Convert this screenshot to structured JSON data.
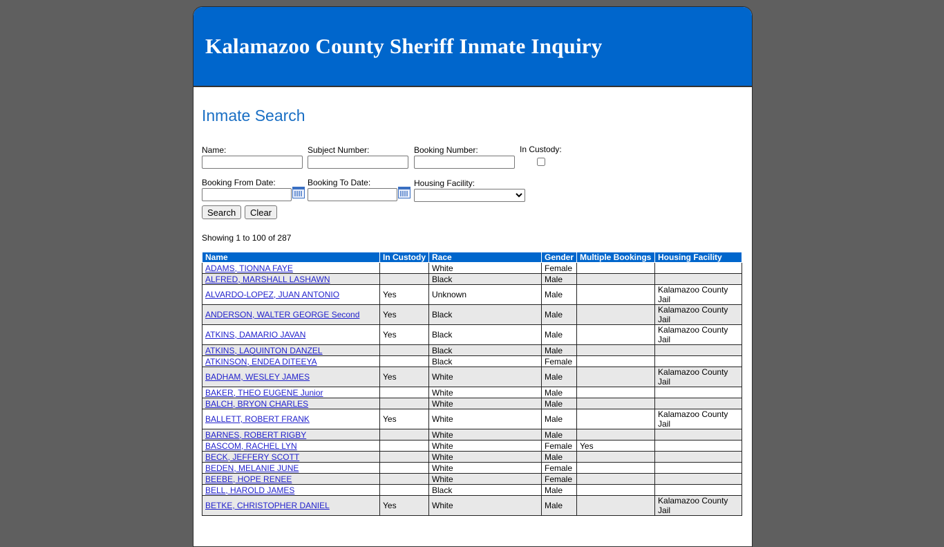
{
  "header": {
    "title": "Kalamazoo County Sheriff Inmate Inquiry"
  },
  "search": {
    "heading": "Inmate Search",
    "name_label": "Name:",
    "subject_label": "Subject Number:",
    "booking_label": "Booking Number:",
    "custody_label": "In Custody:",
    "from_date_label": "Booking From Date:",
    "to_date_label": "Booking To Date:",
    "facility_label": "Housing Facility:",
    "search_button": "Search",
    "clear_button": "Clear"
  },
  "results": {
    "showing": "Showing 1 to 100 of 287",
    "columns": [
      "Name",
      "In Custody",
      "Race",
      "Gender",
      "Multiple Bookings",
      "Housing Facility"
    ],
    "rows": [
      {
        "name": "ADAMS, TIONNA FAYE",
        "custody": "",
        "race": "White",
        "gender": "Female",
        "multiple": "",
        "facility": ""
      },
      {
        "name": "ALFRED, MARSHALL LASHAWN",
        "custody": "",
        "race": "Black",
        "gender": "Male",
        "multiple": "",
        "facility": ""
      },
      {
        "name": "ALVARDO-LOPEZ, JUAN ANTONIO",
        "custody": "Yes",
        "race": "Unknown",
        "gender": "Male",
        "multiple": "",
        "facility": "Kalamazoo County Jail"
      },
      {
        "name": "ANDERSON, WALTER GEORGE Second",
        "custody": "Yes",
        "race": "Black",
        "gender": "Male",
        "multiple": "",
        "facility": "Kalamazoo County Jail"
      },
      {
        "name": "ATKINS, DAMARIO JAVAN",
        "custody": "Yes",
        "race": "Black",
        "gender": "Male",
        "multiple": "",
        "facility": "Kalamazoo County Jail"
      },
      {
        "name": "ATKINS, LAQUINTON DANZEL",
        "custody": "",
        "race": "Black",
        "gender": "Male",
        "multiple": "",
        "facility": ""
      },
      {
        "name": "ATKINSON, ENDEA DITEEYA",
        "custody": "",
        "race": "Black",
        "gender": "Female",
        "multiple": "",
        "facility": ""
      },
      {
        "name": "BADHAM, WESLEY JAMES",
        "custody": "Yes",
        "race": "White",
        "gender": "Male",
        "multiple": "",
        "facility": "Kalamazoo County Jail"
      },
      {
        "name": "BAKER, THEO EUGENE Junior",
        "custody": "",
        "race": "White",
        "gender": "Male",
        "multiple": "",
        "facility": ""
      },
      {
        "name": "BALCH, BRYON CHARLES",
        "custody": "",
        "race": "White",
        "gender": "Male",
        "multiple": "",
        "facility": ""
      },
      {
        "name": "BALLETT, ROBERT FRANK",
        "custody": "Yes",
        "race": "White",
        "gender": "Male",
        "multiple": "",
        "facility": "Kalamazoo County Jail"
      },
      {
        "name": "BARNES, ROBERT RIGBY",
        "custody": "",
        "race": "White",
        "gender": "Male",
        "multiple": "",
        "facility": ""
      },
      {
        "name": "BASCOM, RACHEL LYN",
        "custody": "",
        "race": "White",
        "gender": "Female",
        "multiple": "Yes",
        "facility": ""
      },
      {
        "name": "BECK, JEFFERY SCOTT",
        "custody": "",
        "race": "White",
        "gender": "Male",
        "multiple": "",
        "facility": ""
      },
      {
        "name": "BEDEN, MELANIE JUNE",
        "custody": "",
        "race": "White",
        "gender": "Female",
        "multiple": "",
        "facility": ""
      },
      {
        "name": "BEEBE, HOPE RENEE",
        "custody": "",
        "race": "White",
        "gender": "Female",
        "multiple": "",
        "facility": ""
      },
      {
        "name": "BELL, HAROLD JAMES",
        "custody": "",
        "race": "Black",
        "gender": "Male",
        "multiple": "",
        "facility": ""
      },
      {
        "name": "BETKE, CHRISTOPHER DANIEL",
        "custody": "Yes",
        "race": "White",
        "gender": "Male",
        "multiple": "",
        "facility": "Kalamazoo County Jail"
      }
    ]
  }
}
